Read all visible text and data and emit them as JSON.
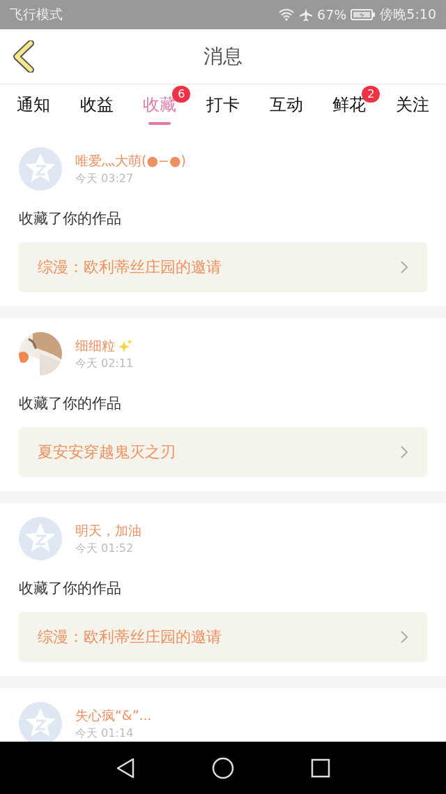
{
  "status_bar": {
    "mode": "飞行模式",
    "battery": "67%",
    "time": "傍晚5:10"
  },
  "header": {
    "title": "消息"
  },
  "tabs": [
    {
      "label": "通知",
      "selected": false
    },
    {
      "label": "收益",
      "selected": false
    },
    {
      "label": "收藏",
      "selected": true,
      "badge": "6"
    },
    {
      "label": "打卡",
      "selected": false
    },
    {
      "label": "互动",
      "selected": false
    },
    {
      "label": "鲜花",
      "selected": false,
      "badge": "2"
    },
    {
      "label": "关注",
      "selected": false
    }
  ],
  "messages": [
    {
      "avatar": {
        "kind": "default"
      },
      "user": "唯爱灬大萌(●−●)",
      "time": "今天 03:27",
      "action": "收藏了你的作品",
      "work": "综漫：欧利蒂丝庄园的邀请"
    },
    {
      "user": "细细粒",
      "sparkle": true,
      "time": "今天 02:11",
      "action": "收藏了你的作品",
      "work": "夏安安穿越鬼灭之刃"
    },
    {
      "avatar": {
        "kind": "default"
      },
      "user": "明天，加油",
      "time": "今天 01:52",
      "action": "收藏了你的作品",
      "work": "综漫：欧利蒂丝庄园的邀请"
    },
    {
      "avatar": {
        "kind": "default"
      },
      "user": "失心疯“&”...",
      "time": "今天 01:14"
    }
  ]
}
